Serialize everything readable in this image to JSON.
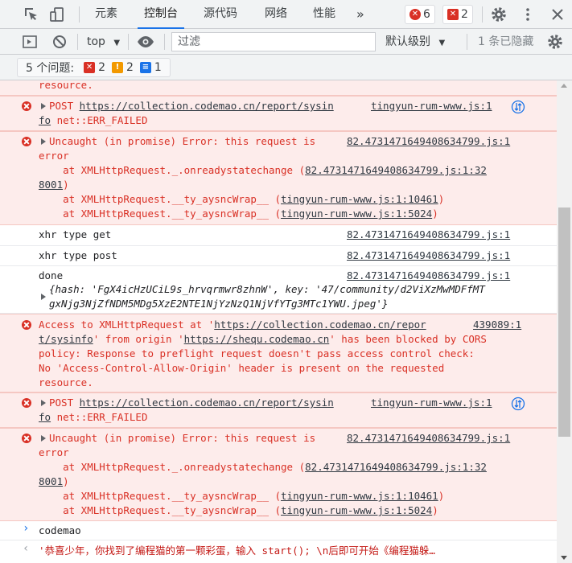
{
  "tabbar": {
    "tabs": [
      "元素",
      "控制台",
      "源代码",
      "网络",
      "性能"
    ],
    "more": "»",
    "error_count": "6",
    "issue_count": "2"
  },
  "toolbar": {
    "context": "top",
    "filter_placeholder": "过滤",
    "levels": "默认级别",
    "hidden": "1 条已隐藏"
  },
  "issues": {
    "label": "5 个问题:",
    "errors": "2",
    "warnings": "2",
    "info": "1"
  },
  "console": {
    "top_partial": "resource.",
    "post1": {
      "method": "POST",
      "url1": "https://collection.codemao.cn/report/sysin",
      "url2": "fo",
      "status": " net::ERR_FAILED",
      "source": "tingyun-rum-www.js:1"
    },
    "uncaught1": {
      "title": "Uncaught (in promise) Error: this request is",
      "title2": "error",
      "source": "82.4731471649408634799.js:1",
      "stack1_prefix": "    at XMLHttpRequest._.onreadystatechange (",
      "stack1_link": "82.4731471649408634799.js:1:32",
      "stack1_cont": "8001",
      "stack2_prefix": "    at XMLHttpRequest.__ty_aysncWrap__ (",
      "stack2_link": "tingyun-rum-www.js:1:10461",
      "stack3_prefix": "    at XMLHttpRequest.__ty_aysncWrap__ (",
      "stack3_link": "tingyun-rum-www.js:1:5024"
    },
    "log1": {
      "text": "xhr type get",
      "source": "82.4731471649408634799.js:1"
    },
    "log2": {
      "text": "xhr type post",
      "source": "82.4731471649408634799.js:1"
    },
    "done": {
      "text": "done",
      "source": "82.4731471649408634799.js:1",
      "obj_line1": "{hash: 'FgX4icHzUCiL9s_hrvqrmwr8zhnW', key: '47/community/d2ViXzMwMDFfMT",
      "obj_line2": "gxNjg3NjZfNDM5MDg5XzE2NTE1NjYzNzQ1NjVfYTg3MTc1YWU.jpeg'}"
    },
    "cors": {
      "l1_a": "Access to XMLHttpRequest at '",
      "l1_link": "https://collection.codemao.cn/repor",
      "l1_src": "439089:1",
      "l2_link": "t/sysinfo",
      "l2_b": "' from origin '",
      "l2_link2": "https://shequ.codemao.cn",
      "l2_c": "' has been blocked by CORS",
      "l3": "policy: Response to preflight request doesn't pass access control check:",
      "l4": "No 'Access-Control-Allow-Origin' header is present on the requested",
      "l5": "resource."
    },
    "prompt": "codemao",
    "result": "'恭喜少年，你找到了编程猫的第一颗彩蛋，输入 start(); \\n后即可开始《编程猫躲…"
  }
}
